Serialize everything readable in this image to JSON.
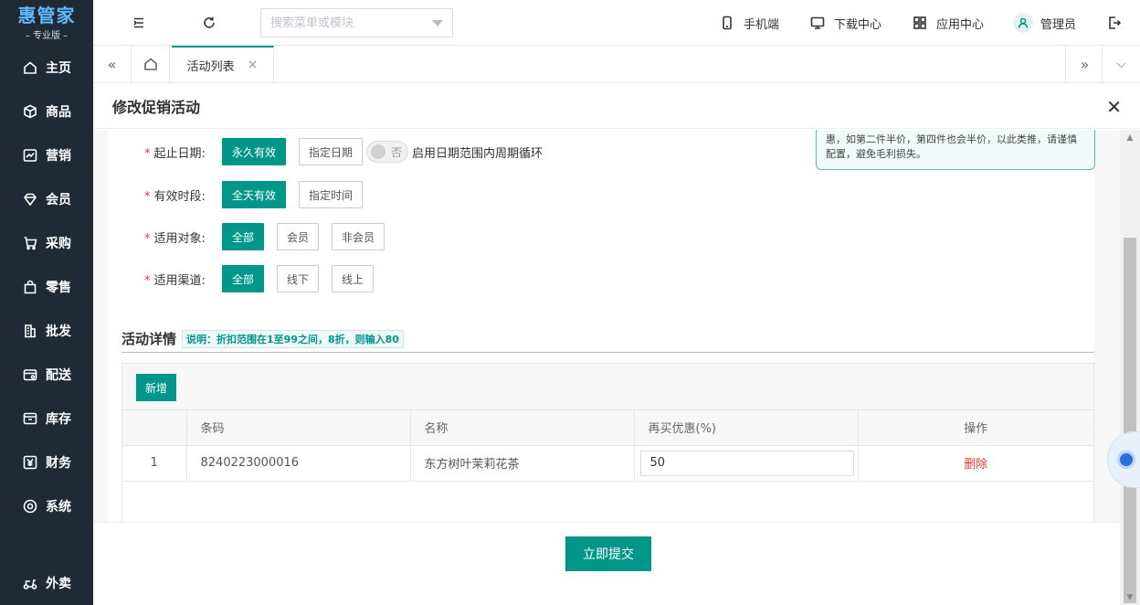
{
  "brand": {
    "name": "惠管家",
    "edition": "– 专业版 –"
  },
  "sidebar": {
    "items": [
      {
        "label": "主页",
        "icon": "home-icon"
      },
      {
        "label": "商品",
        "icon": "box-icon"
      },
      {
        "label": "营销",
        "icon": "chart-icon"
      },
      {
        "label": "会员",
        "icon": "diamond-icon"
      },
      {
        "label": "采购",
        "icon": "cart-icon"
      },
      {
        "label": "零售",
        "icon": "bag-icon"
      },
      {
        "label": "批发",
        "icon": "building-icon"
      },
      {
        "label": "配送",
        "icon": "delivery-icon"
      },
      {
        "label": "库存",
        "icon": "inventory-icon"
      },
      {
        "label": "财务",
        "icon": "yen-icon"
      },
      {
        "label": "系统",
        "icon": "gear-icon"
      }
    ],
    "bottom_item": {
      "label": "外卖",
      "icon": "scooter-icon"
    }
  },
  "topbar": {
    "search_placeholder": "搜索菜单或模块",
    "links": {
      "mobile": "手机端",
      "download": "下载中心",
      "apps": "应用中心",
      "user": "管理员"
    }
  },
  "tabs": {
    "active_label": "活动列表"
  },
  "dialog": {
    "title": "修改促销活动",
    "notice": "惠，如第二件半价，第四件也会半价，以此类推，请谨慎配置，避免毛利损失。",
    "form": {
      "date": {
        "label": "起止日期:",
        "options": [
          "永久有效",
          "指定日期"
        ],
        "toggle_label": "否",
        "toggle_text": "启用日期范围内周期循环"
      },
      "period": {
        "label": "有效时段:",
        "options": [
          "全天有效",
          "指定时间"
        ]
      },
      "target": {
        "label": "适用对象:",
        "options": [
          "全部",
          "会员",
          "非会员"
        ]
      },
      "channel": {
        "label": "适用渠道:",
        "options": [
          "全部",
          "线下",
          "线上"
        ]
      }
    },
    "detail": {
      "title": "活动详情",
      "hint": "说明：折扣范围在1至99之间，8折，则输入80",
      "add_label": "新增",
      "columns": [
        "",
        "条码",
        "名称",
        "再买优惠(%)",
        "操作"
      ],
      "rows": [
        {
          "index": "1",
          "barcode": "8240223000016",
          "name": "东方树叶茉莉花茶",
          "discount": "50",
          "action": "删除"
        }
      ]
    },
    "submit_label": "立即提交"
  },
  "colors": {
    "accent": "#00968a",
    "danger": "#e4393c",
    "sidebar_bg": "#1f2a34"
  }
}
